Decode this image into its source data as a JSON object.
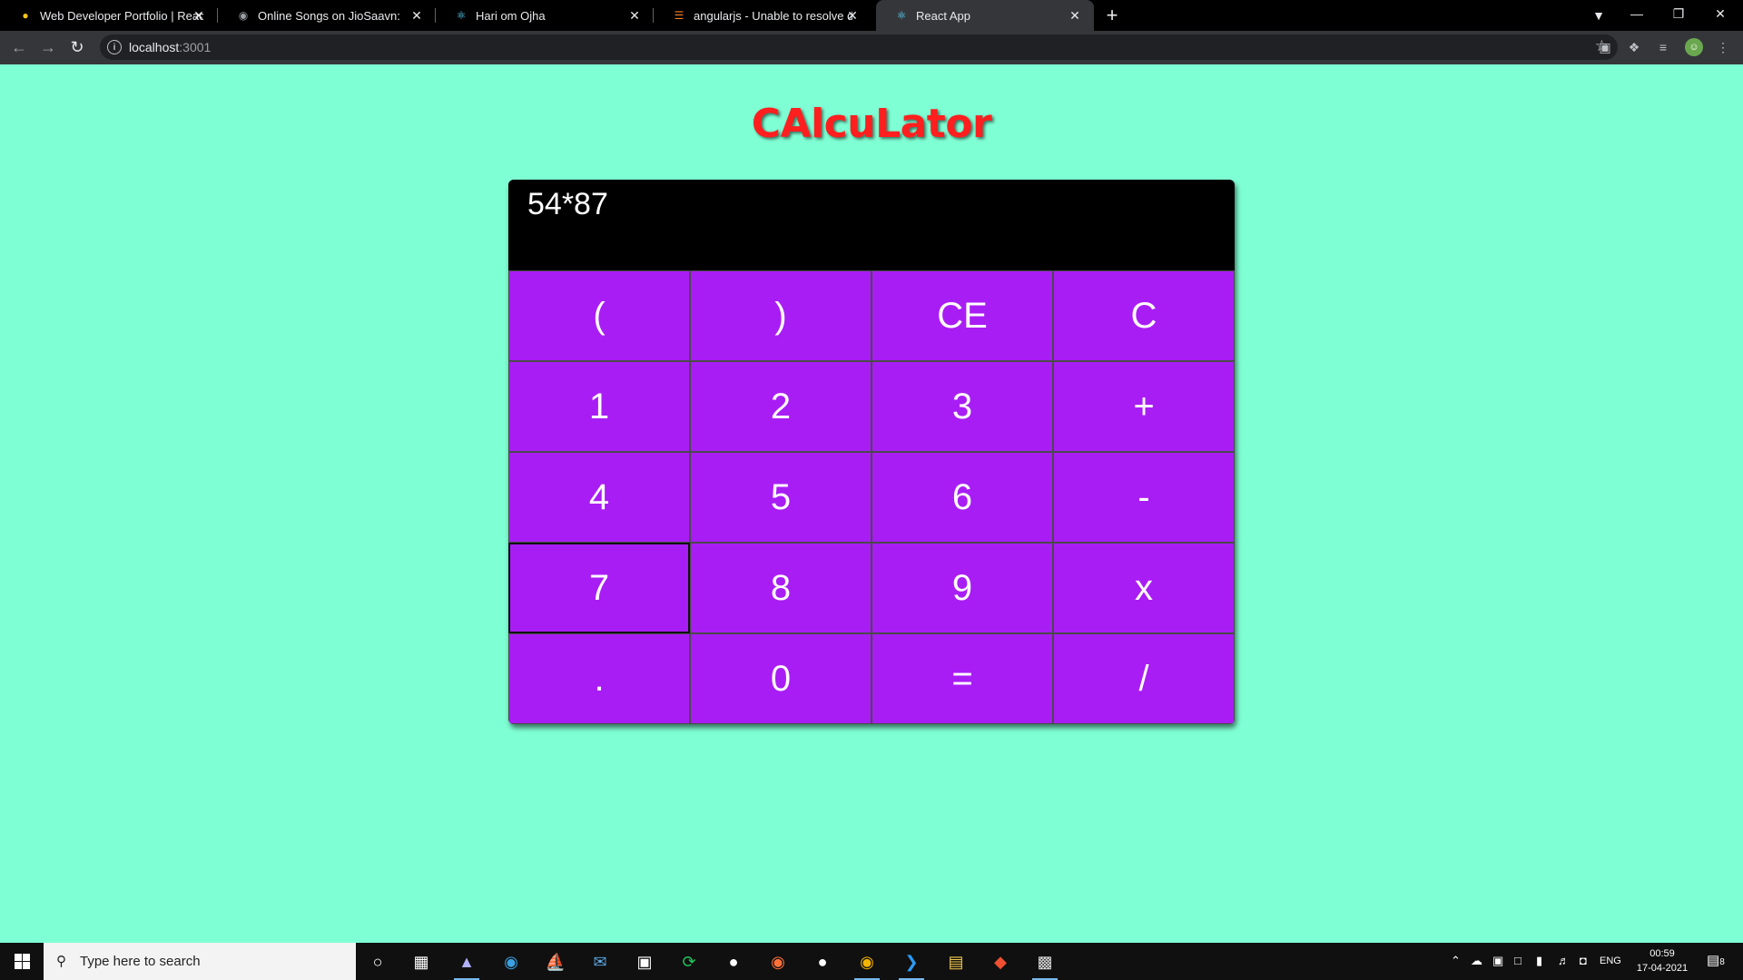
{
  "browser": {
    "tabs": [
      {
        "title": "Web Developer Portfolio | React,",
        "icon": "lightbulb-icon"
      },
      {
        "title": "Online Songs on JioSaavn: D",
        "icon": "jiosaavn-icon"
      },
      {
        "title": "Hari om Ojha",
        "icon": "react-icon"
      },
      {
        "title": "angularjs - Unable to resolve dep",
        "icon": "stackoverflow-icon"
      },
      {
        "title": "React App",
        "icon": "react-icon"
      }
    ],
    "address": {
      "host": "localhost",
      "port": ":3001"
    }
  },
  "app": {
    "title": "CAlcuLator",
    "display_expression": "54*87",
    "keys": [
      [
        "(",
        ")",
        "CE",
        "C"
      ],
      [
        "1",
        "2",
        "3",
        "+"
      ],
      [
        "4",
        "5",
        "6",
        "-"
      ],
      [
        "7",
        "8",
        "9",
        "x"
      ],
      [
        ".",
        "0",
        "=",
        "/"
      ]
    ],
    "colors": {
      "background": "#7fffd4",
      "keypad": "#a91df5",
      "display": "#000000",
      "title": "#ff1f1f"
    }
  },
  "taskbar": {
    "search_placeholder": "Type here to search",
    "language": "ENG",
    "time": "00:59",
    "date": "17-04-2021",
    "notification_count": "8"
  }
}
